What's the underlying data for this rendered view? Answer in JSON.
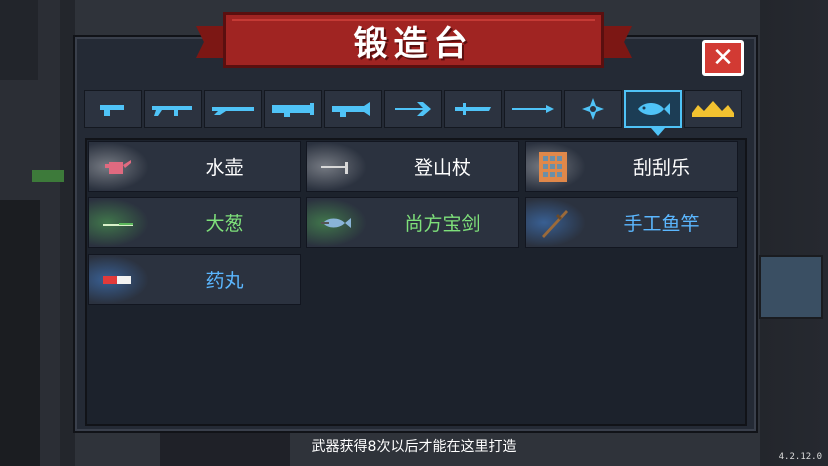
{
  "title": "锻造台",
  "close_label": "✕",
  "tabs": [
    {
      "icon": "pistol-icon",
      "active": false
    },
    {
      "icon": "rifle-icon",
      "active": false
    },
    {
      "icon": "shotgun-icon",
      "active": false
    },
    {
      "icon": "launcher-icon",
      "active": false
    },
    {
      "icon": "laser-gun-icon",
      "active": false
    },
    {
      "icon": "bow-icon",
      "active": false
    },
    {
      "icon": "sword-icon",
      "active": false
    },
    {
      "icon": "spear-icon",
      "active": false
    },
    {
      "icon": "shuriken-icon",
      "active": false
    },
    {
      "icon": "fish-icon",
      "active": true
    },
    {
      "icon": "crown-icon",
      "active": false
    }
  ],
  "items": [
    {
      "label": "水壶",
      "color": "#ffffff",
      "glow": "white",
      "icon": "watering-can-icon"
    },
    {
      "label": "登山杖",
      "color": "#ffffff",
      "glow": "white",
      "icon": "hiking-pole-icon"
    },
    {
      "label": "刮刮乐",
      "color": "#ffffff",
      "glow": "white",
      "icon": "scratch-card-icon"
    },
    {
      "label": "大葱",
      "color": "#7ee07a",
      "glow": "green",
      "icon": "scallion-icon"
    },
    {
      "label": "尚方宝剑",
      "color": "#7ee07a",
      "glow": "green",
      "icon": "fish-sword-icon"
    },
    {
      "label": "手工鱼竿",
      "color": "#5bb7ff",
      "glow": "blue",
      "icon": "fishing-rod-icon"
    },
    {
      "label": "药丸",
      "color": "#5bb7ff",
      "glow": "blue",
      "icon": "pill-icon"
    }
  ],
  "footer_note": "武器获得8次以后才能在这里打造",
  "version": "4.2.12.0",
  "colors": {
    "accent": "#4fc3f7",
    "banner": "#a02422",
    "close": "#d23a33"
  }
}
